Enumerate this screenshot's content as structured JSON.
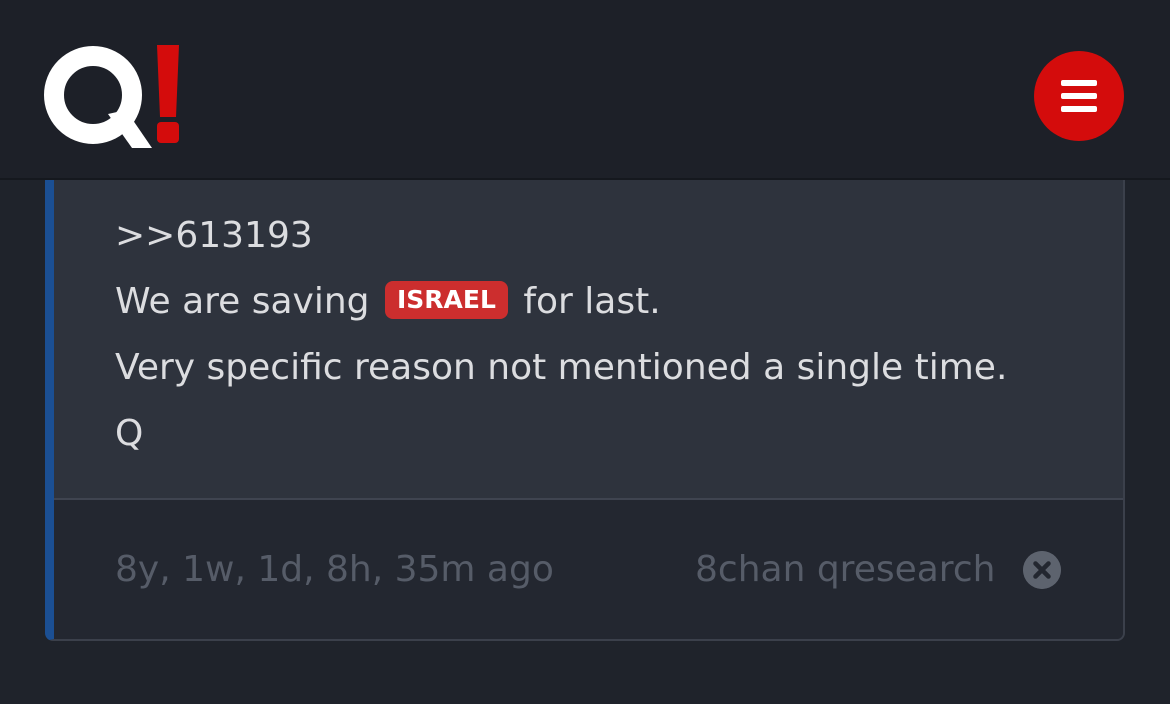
{
  "header": {
    "logo": {
      "letter": "Q",
      "mark": "!",
      "letter_color": "#ffffff",
      "mark_color": "#d40c0c"
    },
    "menu_icon": "hamburger-menu-icon",
    "accent_color": "#d40c0c"
  },
  "post": {
    "reference": ">>613193",
    "line2_before": "We are saving",
    "tag": "ISRAEL",
    "line2_after": "for last.",
    "line3": "Very specific reason not mentioned a single time.",
    "signature": "Q",
    "accent_color": "#1b4f93",
    "tag_color": "#cc2e2e"
  },
  "footer": {
    "timestamp": "8y, 1w, 1d, 8h, 35m ago",
    "source": "8chan qresearch",
    "close_icon": "close-icon"
  }
}
